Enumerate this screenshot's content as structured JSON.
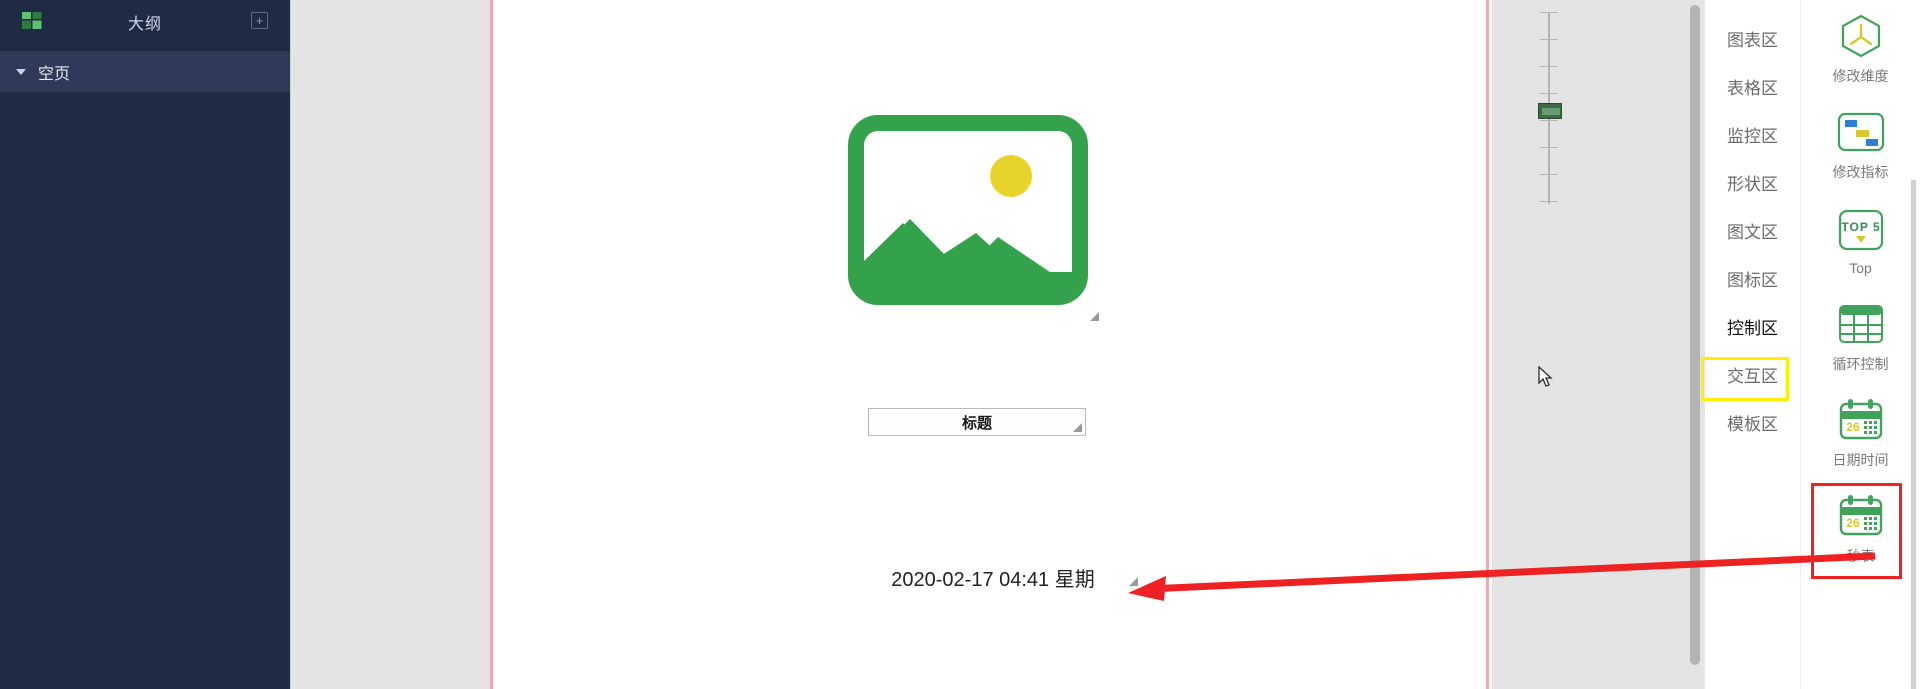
{
  "outline": {
    "grid_icon": "grid-layout-icon",
    "title": "大纲",
    "add_label": "+",
    "items": [
      {
        "label": "空页",
        "caret": "caret-down-icon"
      }
    ]
  },
  "canvas": {
    "image_widget": {
      "icon": "image-placeholder-icon",
      "frame_color": "#33a24a",
      "sun_color": "#e8d32a",
      "handle": "resize-handle-icon"
    },
    "title_widget": {
      "text": "标题",
      "handle": "resize-handle-icon"
    },
    "date_widget": {
      "text": "2020-02-17 04:41 星期",
      "handle": "resize-handle-icon"
    },
    "border_color": "#eeaab0"
  },
  "zoom_panel": {
    "slider_name": "zoom-slider",
    "thumb_color": "#3f6b44",
    "tick_count": 8
  },
  "categories": {
    "active": "控制区",
    "highlight_color": "#ffee00",
    "items": [
      {
        "label": "图表区"
      },
      {
        "label": "表格区"
      },
      {
        "label": "监控区"
      },
      {
        "label": "形状区"
      },
      {
        "label": "图文区"
      },
      {
        "label": "图标区"
      },
      {
        "label": "控制区"
      },
      {
        "label": "交互区"
      },
      {
        "label": "模板区"
      }
    ]
  },
  "widgets": {
    "highlight_color": "#ee2222",
    "selected": "日期时间",
    "items": [
      {
        "label": "修改维度",
        "icon": "hexagon-dimension-icon"
      },
      {
        "label": "修改指标",
        "icon": "metric-blocks-icon"
      },
      {
        "label": "Top",
        "icon": "top5-icon",
        "badge": "TOP 5"
      },
      {
        "label": "循环控制",
        "icon": "table-grid-icon"
      },
      {
        "label": "日期时间",
        "icon": "calendar-icon",
        "day": "26"
      },
      {
        "label": "秒表",
        "icon": "calendar-icon",
        "day": "26"
      }
    ]
  },
  "annotation": {
    "arrow_color": "#ee2222",
    "name": "red-pointer-arrow"
  },
  "cursor": {
    "name": "mouse-cursor"
  }
}
